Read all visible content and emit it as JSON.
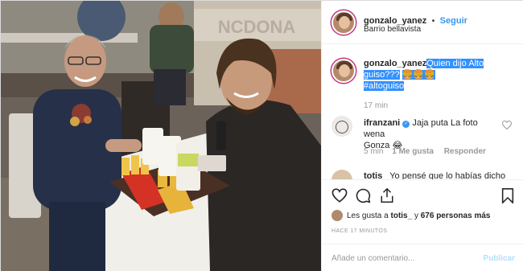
{
  "post": {
    "username": "gonzalo_yanez",
    "follow_separator": "•",
    "follow_label": "Seguir",
    "location": "Barrio bellavista"
  },
  "caption": {
    "username": "gonzalo_yanez",
    "text_line1": "Quien dijo Alto",
    "text_line2": "guiso???",
    "emojis": "🍔🍔🍔",
    "hashtag": "#altoguiso",
    "time": "17 min"
  },
  "comments": [
    {
      "username": "ifranzani",
      "text_line1": "Jaja puta La foto wena",
      "text_line2": "Gonza",
      "emoji": "😂",
      "time": "5 min",
      "likes": "1 Me gusta",
      "reply": "Responder"
    },
    {
      "username": "totis_",
      "text_line1": "Yo pensé que lo habías dicho"
    }
  ],
  "likes": {
    "prefix": "Les gusta a",
    "user": "totis_",
    "joiner": "y",
    "count": "676 personas más"
  },
  "posted_ago": "HACE 17 MINUTOS",
  "add_comment": {
    "placeholder": "Añade un comentario...",
    "publish": "Publicar"
  },
  "icons": [
    "heart-icon",
    "comment-icon",
    "share-icon",
    "bookmark-icon",
    "comment-like-icon",
    "verified-icon"
  ],
  "colors": {
    "link_blue": "#3897f0",
    "highlight": "#3390ff",
    "muted": "#999999",
    "publish_disabled": "#b2dffc"
  }
}
